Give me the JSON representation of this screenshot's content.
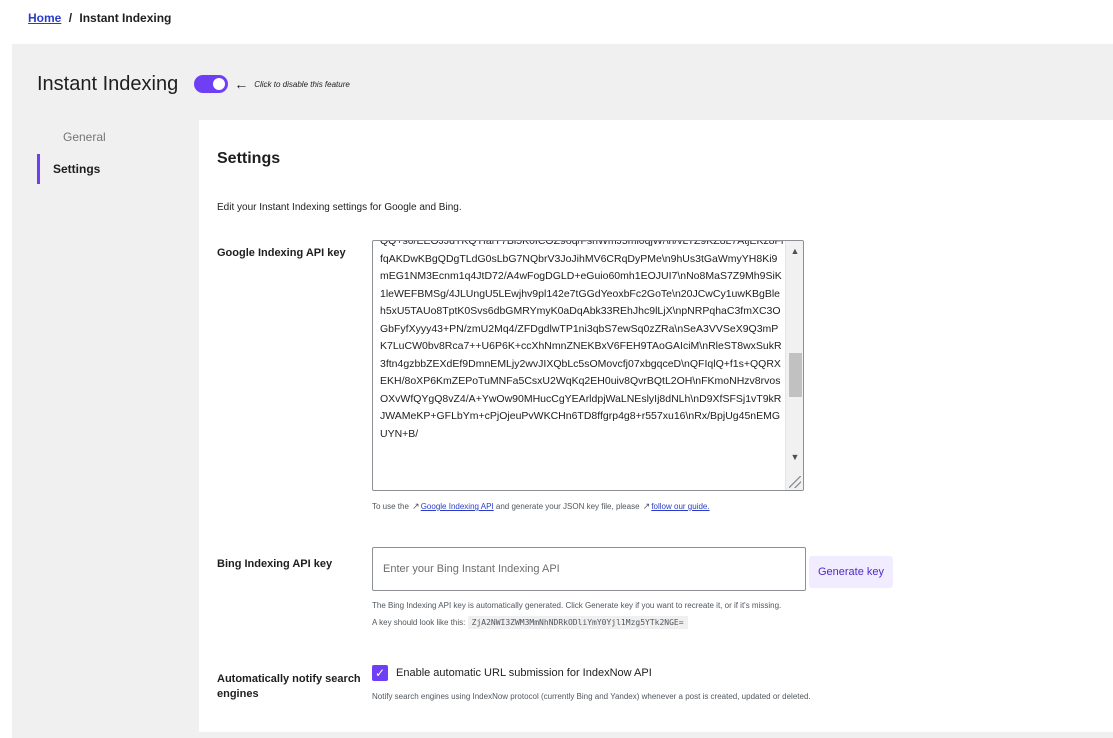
{
  "breadcrumb": {
    "home": "Home",
    "separator": "/",
    "current": "Instant Indexing"
  },
  "header": {
    "title": "Instant Indexing",
    "toggle_on": true,
    "arrow": "←",
    "hint": "Click to disable this feature"
  },
  "sidenav": {
    "items": [
      {
        "label": "General",
        "active": false
      },
      {
        "label": "Settings",
        "active": true
      }
    ]
  },
  "settings": {
    "title": "Settings",
    "description": "Edit your Instant Indexing settings for Google and Bing.",
    "google": {
      "label": "Google Indexing API key",
      "value": "QQ+s0/EEOJJdTKQTfaiY7Bi5K0ICOZ9oq/FsnWmJ5mi0qjW/\\n/vLTZ9KZ8L7AtjEKz8FlfqAKDwKBgQDgTLdG0sLbG7NQbrV3JoJihMV6CRqDyPMe\\n9hUs3tGaWmyYH8Ki9mEG1NM3Ecnm1q4JtD72/A4wFogDGLD+eGuio60mh1EOJUI7\\nNo8MaS7Z9Mh9SiK1leWEFBMSg/4JLUngU5LEwjhv9pl142e7tGGdYeoxbFc2GoTe\\n20JCwCy1uwKBgBleh5xU5TAUo8TptK0Svs6dbGMRYmyK0aDqAbk33REhJhc9lLjX\\npNRPqhaC3fmXC3OGbFyfXyyy43+PN/zmU2Mq4/ZFDgdlwTP1ni3qbS7ewSq0zZRa\\nSeA3VVSeX9Q3mPK7LuCW0bv8Rca7++U6P6K+ccXhNmnZNEKBxV6FEH9TAoGAIciM\\nRleST8wxSukR3ftn4gzbbZEXdEf9DmnEMLjy2wvJIXQbLc5sOMovcfj07xbgqceD\\nQFIqlQ+f1s+QQRXEKH/8oXP6KmZEPoTuMNFa5CsxU2WqKq2EH0uiv8QvrBQtL2OH\\nFKmoNHzv8rvosOXvWfQYgQ8vZ4/A+YwOw90MHucCgYEArldpjWaLNEslyIj8dNLh\\nD9XfSFSj1vT9kRJWAMeKP+GFLbYm+cPjOjeuPvWKCHn6TD8ffgrp4g8+r557xu16\\nRx/BpjUg45nEMGUYN+B/",
      "note_prefix": "To use the",
      "api_link": "Google Indexing API",
      "note_middle": "and generate your JSON key file, please",
      "guide_link": "follow our guide."
    },
    "bing": {
      "label": "Bing Indexing API key",
      "placeholder": "Enter your Bing Instant Indexing API",
      "button": "Generate key",
      "note1": "The Bing Indexing API key is automatically generated. Click Generate key if you want to recreate it, or if it's missing.",
      "note2_prefix": "A key should look like this:",
      "example": "ZjA2NWI3ZWM3MmNhNDRkODliYmY0Yjl1Mzg5YTk2NGE="
    },
    "notify": {
      "label": "Automatically notify search engines",
      "checked": true,
      "checkbox_label": "Enable automatic URL submission for IndexNow API",
      "note": "Notify search engines using IndexNow protocol (currently Bing and Yandex) whenever a post is created, updated or deleted."
    }
  },
  "colors": {
    "accent": "#6f3ff5",
    "link": "#2a3cc9",
    "background": "#f0f0f1"
  }
}
